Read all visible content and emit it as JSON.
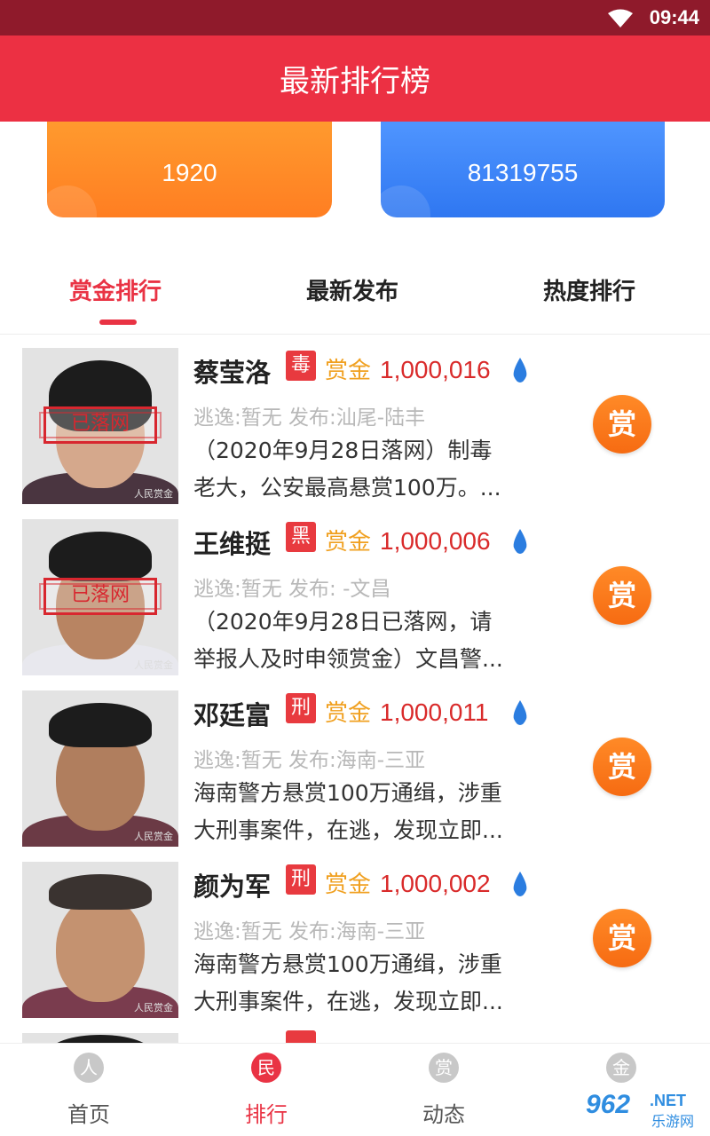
{
  "status_bar": {
    "time": "09:44"
  },
  "header": {
    "title": "最新排行榜"
  },
  "stats": {
    "left_value": "1920",
    "right_value": "81319755"
  },
  "tabs": [
    {
      "label": "赏金排行",
      "active": true
    },
    {
      "label": "最新发布",
      "active": false
    },
    {
      "label": "热度排行",
      "active": false
    }
  ],
  "bounty_label": "赏金",
  "reward_button_label": "赏",
  "photo_watermark": "人民赏金",
  "items": [
    {
      "name": "蔡莹洛",
      "tag": "毒",
      "amount": "1,000,016",
      "info": "逃逸:暂无  发布:汕尾-陆丰",
      "desc_line1": "（2020年9月28日落网）制毒",
      "desc_line2": "老大，公安最高悬赏100万。...",
      "stamp": "已落网"
    },
    {
      "name": "王维挺",
      "tag": "黑",
      "amount": "1,000,006",
      "info": "逃逸:暂无  发布: -文昌",
      "desc_line1": "（2020年9月28日已落网，请",
      "desc_line2": "举报人及时申领赏金）文昌警...",
      "stamp": "已落网"
    },
    {
      "name": "邓廷富",
      "tag": "刑",
      "amount": "1,000,011",
      "info": "逃逸:暂无  发布:海南-三亚",
      "desc_line1": "海南警方悬赏100万通缉，涉重",
      "desc_line2": "大刑事案件，在逃，发现立即..."
    },
    {
      "name": "颜为军",
      "tag": "刑",
      "amount": "1,000,002",
      "info": "逃逸:暂无  发布:海南-三亚",
      "desc_line1": "海南警方悬赏100万通缉，涉重",
      "desc_line2": "大刑事案件，在逃，发现立即..."
    }
  ],
  "bottom_nav": [
    {
      "icon_char": "人",
      "label": "首页",
      "active": false
    },
    {
      "icon_char": "民",
      "label": "排行",
      "active": true
    },
    {
      "icon_char": "赏",
      "label": "动态",
      "active": false
    },
    {
      "icon_char": "金",
      "label": "",
      "active": false
    }
  ],
  "watermark_logo": {
    "big": "962",
    "net": ".NET",
    "cn": "乐游网"
  },
  "colors": {
    "primary": "#ec3043",
    "status_bar": "#8f1a2b",
    "orange_card": "#ff8a27",
    "blue_card": "#3a83f6",
    "amount": "#d92a2a",
    "bounty": "#f0a020"
  }
}
